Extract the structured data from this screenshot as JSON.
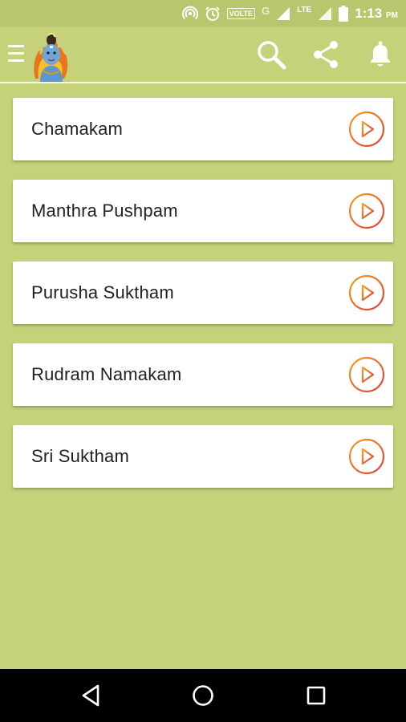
{
  "status_bar": {
    "volte_label": "VOLTE",
    "network_g": "G",
    "network_lte": "LTE",
    "time": "1:13",
    "ampm": "PM"
  },
  "app_bar": {
    "menu_icon": "hamburger-icon",
    "avatar": "deity-avatar",
    "actions": [
      "search-icon",
      "share-icon",
      "bell-icon"
    ]
  },
  "items": [
    {
      "label": "Chamakam"
    },
    {
      "label": "Manthra Pushpam"
    },
    {
      "label": "Purusha Suktham"
    },
    {
      "label": "Rudram Namakam"
    },
    {
      "label": "Sri Suktham"
    }
  ],
  "colors": {
    "background": "#c5d27a",
    "status_bar": "#b8c66d",
    "play_gradient_start": "#f4a020",
    "play_gradient_end": "#e53935",
    "card": "#ffffff"
  },
  "nav": [
    "back-icon",
    "home-icon",
    "recent-apps-icon"
  ]
}
